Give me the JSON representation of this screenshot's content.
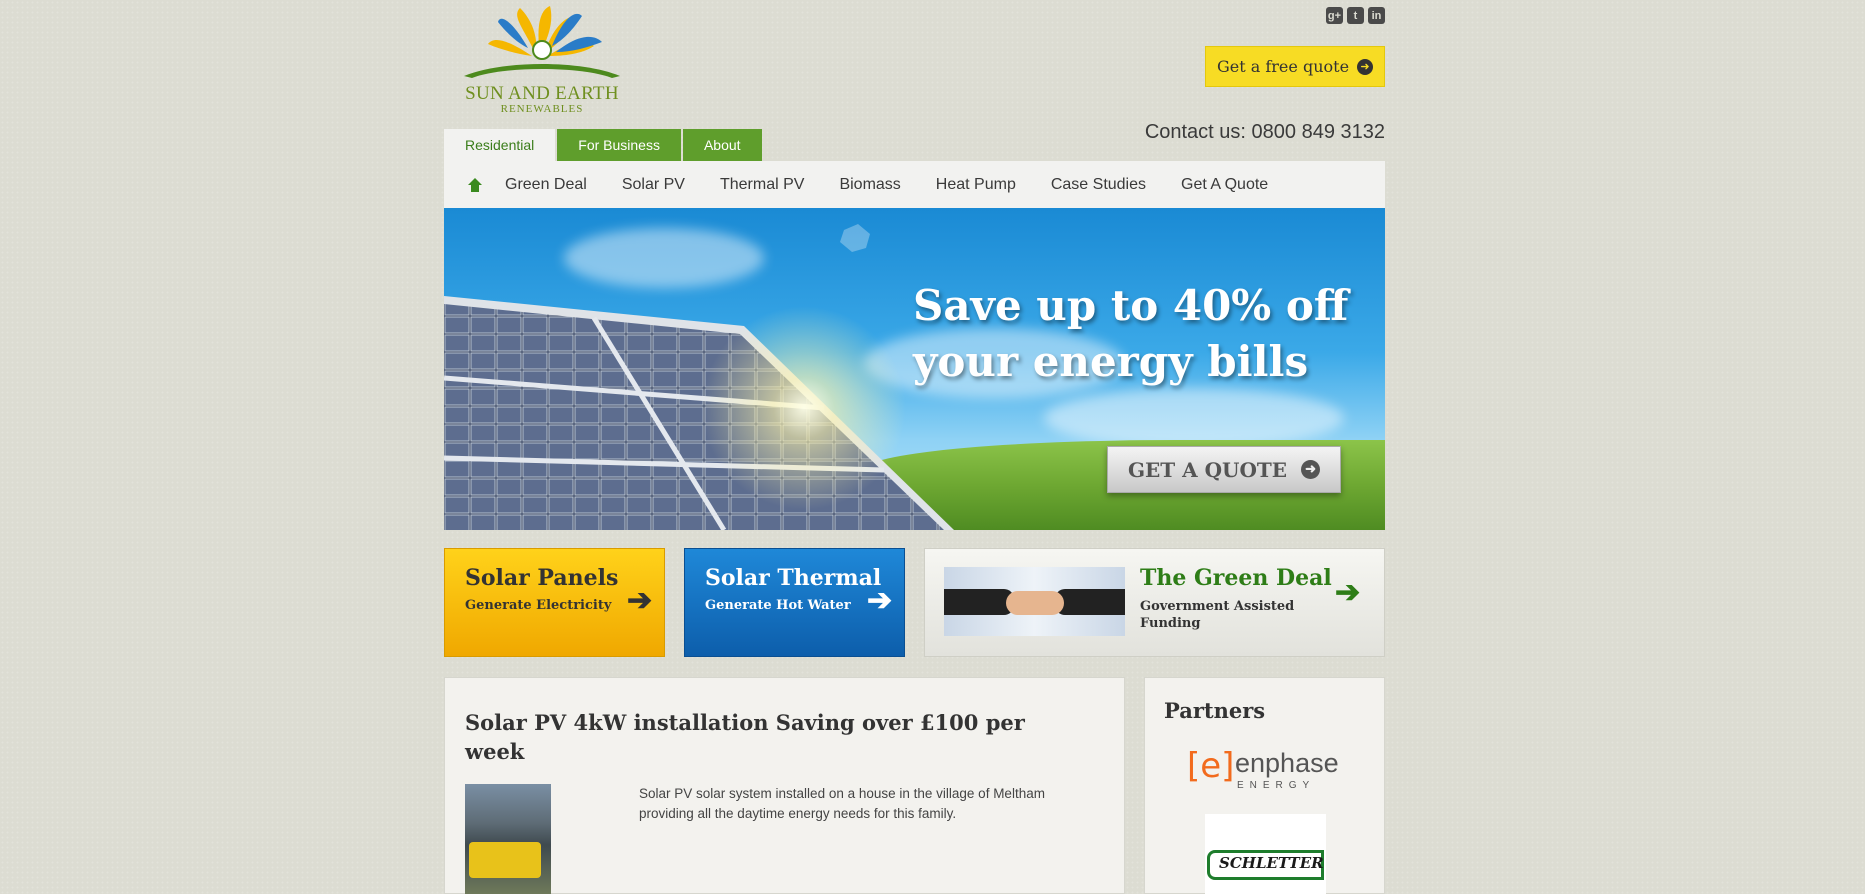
{
  "brand": {
    "name": "SUN AND EARTH",
    "subtitle": "RENEWABLES"
  },
  "social": {
    "icons": [
      "google-plus-icon",
      "twitter-icon",
      "linkedin-icon"
    ],
    "labels": [
      "g+",
      "t",
      "in"
    ]
  },
  "header": {
    "quote_button": "Get a free quote",
    "contact": "Contact us: 0800 849 3132"
  },
  "tabs": [
    {
      "label": "Residential",
      "active": true
    },
    {
      "label": "For Business",
      "active": false
    },
    {
      "label": "About",
      "active": false
    }
  ],
  "nav": {
    "home_icon": "home-icon",
    "items": [
      "Green Deal",
      "Solar PV",
      "Thermal PV",
      "Biomass",
      "Heat Pump",
      "Case Studies",
      "Get A Quote"
    ]
  },
  "hero": {
    "headline": "Save up to 40% off your energy bills",
    "cta": "GET A QUOTE"
  },
  "features": [
    {
      "title": "Solar Panels",
      "subtitle": "Generate Electricity",
      "color": "#f5b700"
    },
    {
      "title": "Solar Thermal",
      "subtitle": "Generate Hot Water",
      "color": "#1672c4"
    },
    {
      "title": "The Green Deal",
      "subtitle": "Government Assisted Funding",
      "color": "#2e7d17"
    }
  ],
  "article": {
    "title": "Solar PV 4kW installation Saving over £100 per week",
    "description": "Solar PV solar system installed on a house in the village of Meltham providing all the daytime energy needs for this family."
  },
  "partners": {
    "heading": "Partners",
    "logos": [
      {
        "bracket": "[e]",
        "name": "enphase",
        "tagline": "ENERGY"
      },
      {
        "name": "SCHLETTER"
      }
    ]
  },
  "colors": {
    "accent_green": "#5f9e2c",
    "quote_yellow": "#f7dc24",
    "background": "#dcdcd2"
  }
}
